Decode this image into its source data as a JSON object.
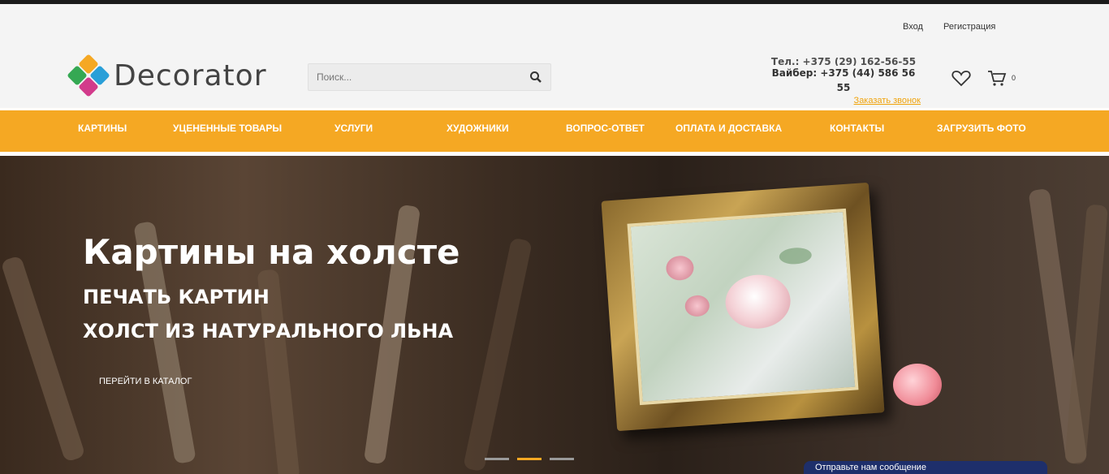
{
  "header": {
    "logo_text": "Decorator",
    "search_placeholder": "Поиск...",
    "login": "Вход",
    "register": "Регистрация",
    "phone1": "Тел.: +375 (29) 162-56-55",
    "phone2": "Вайбер: +375 (44) 586 56 55",
    "callback": "Заказать звонок",
    "cart_count": "0"
  },
  "nav": {
    "items": [
      "КАРТИНЫ",
      "УЦЕНЕННЫЕ ТОВАРЫ",
      "УСЛУГИ",
      "ХУДОЖНИКИ",
      "ВОПРОС-ОТВЕТ",
      "ОПЛАТА И ДОСТАВКА",
      "КОНТАКТЫ",
      "ЗАГРУЗИТЬ ФОТО"
    ]
  },
  "hero": {
    "title": "Картины на холсте",
    "sub1": "ПЕЧАТЬ КАРТИН",
    "sub2": "ХОЛСТ ИЗ НАТУРАЛЬНОГО ЛЬНА",
    "cta": "ПЕРЕЙТИ В КАТАЛОГ",
    "slides": 3,
    "active_slide": 2
  },
  "chat": {
    "label": "Отправьте нам сообщение"
  },
  "colors": {
    "accent": "#f5a823",
    "callback": "#f0a30a"
  },
  "icons": [
    "search-icon",
    "heart-icon",
    "cart-icon",
    "logo-icon"
  ]
}
